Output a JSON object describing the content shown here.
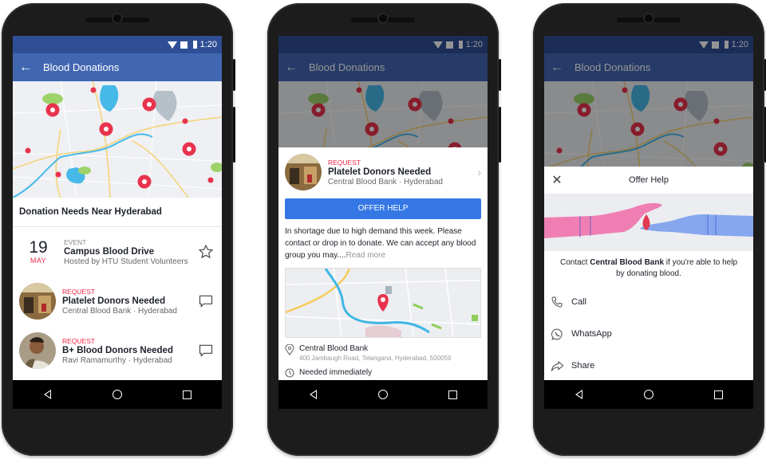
{
  "status_bar": {
    "time": "1:20"
  },
  "app_bar": {
    "title": "Blood Donations"
  },
  "panel1": {
    "section_title": "Donation Needs Near Hyderabad",
    "items": [
      {
        "type": "event",
        "day": "19",
        "month": "MAY",
        "kicker": "EVENT",
        "name": "Campus Blood Drive",
        "sub": "Hosted by HTU Student Volunteers",
        "action_icon": "star-icon"
      },
      {
        "type": "request",
        "kicker": "REQUEST",
        "name": "Platelet Donors Needed",
        "sub": "Central Blood Bank · Hyderabad",
        "action_icon": "comment-icon"
      },
      {
        "type": "request",
        "kicker": "REQUEST",
        "name": "B+ Blood Donors Needed",
        "sub": "Ravi Ramamurthy · Hyderabad",
        "action_icon": "comment-icon"
      }
    ]
  },
  "panel2": {
    "kicker": "REQUEST",
    "name": "Platelet Donors Needed",
    "sub": "Central Blood Bank · Hyderabad",
    "button": "OFFER HELP",
    "description": "In shortage due to high demand this week. Please contact or drop in to donate. We can accept any blood group you may....",
    "read_more": "Read more",
    "location_name": "Central Blood Bank",
    "location_address": "400 Jambaugh Road, Telangana, Hyderabad, 500059",
    "urgency": "Needed immediately"
  },
  "panel3": {
    "title": "Offer Help",
    "contact_prefix": "Contact ",
    "contact_org": "Central Blood Bank",
    "contact_suffix": " if you're able to help by donating blood.",
    "actions": [
      {
        "label": "Call",
        "icon": "phone-icon"
      },
      {
        "label": "WhatsApp",
        "icon": "whatsapp-icon"
      },
      {
        "label": "Share",
        "icon": "share-icon"
      }
    ]
  },
  "colors": {
    "brand": "#4267b2",
    "button": "#3578e5",
    "accent_red": "#f02849"
  }
}
